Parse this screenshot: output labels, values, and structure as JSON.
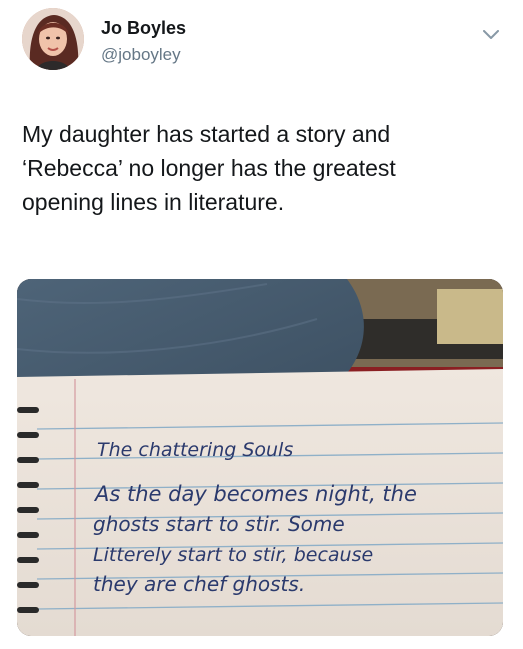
{
  "author": {
    "display_name": "Jo Boyles",
    "handle": "@joboyley"
  },
  "menu_icon": "chevron-down-icon",
  "tweet_text": [
    "My daughter has started a story and",
    "‘Rebecca’ no longer has the greatest",
    "opening lines in literature."
  ],
  "photo": {
    "notebook_title": "The chattering Souls",
    "notebook_lines": [
      "As the day becomes night, the",
      "ghosts start to stir. Some",
      "Litterely start to stir, because",
      "they are chef ghosts."
    ]
  }
}
